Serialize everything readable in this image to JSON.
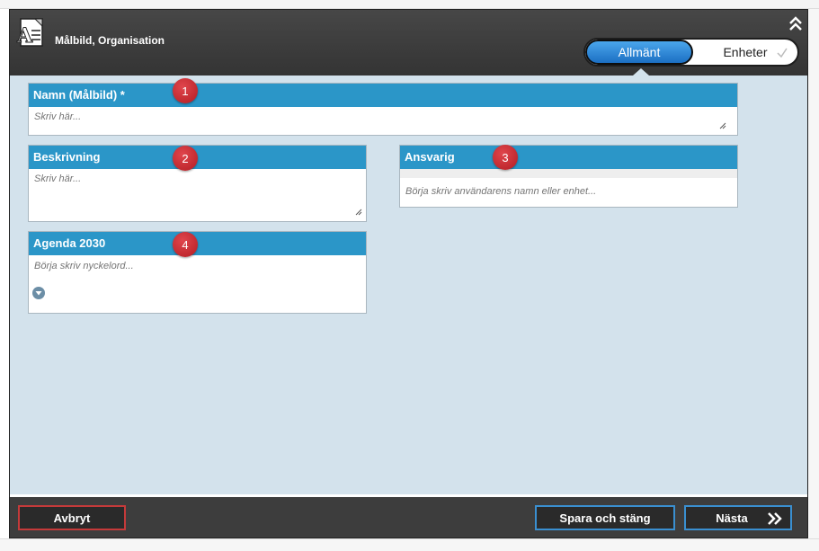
{
  "header": {
    "title": "Målbild, Organisation",
    "tabs": [
      {
        "label": "Allmänt",
        "active": true
      },
      {
        "label": "Enheter",
        "active": false
      }
    ]
  },
  "fields": {
    "name": {
      "label": "Namn (Målbild) *",
      "placeholder": "Skriv här...",
      "badge": "1"
    },
    "description": {
      "label": "Beskrivning",
      "placeholder": "Skriv här...",
      "badge": "2"
    },
    "responsible": {
      "label": "Ansvarig",
      "placeholder": "Börja skriv användarens namn eller enhet...",
      "badge": "3"
    },
    "agenda": {
      "label": "Agenda 2030",
      "placeholder": "Börja skriv nyckelord...",
      "badge": "4"
    }
  },
  "footer": {
    "cancel_label": "Avbryt",
    "save_close_label": "Spara och stäng",
    "next_label": "Nästa"
  },
  "colors": {
    "accent": "#2b96c8",
    "badge": "#c4262d",
    "content_bg": "#d3e2ec",
    "cancel_border": "#c43a3a",
    "primary_border": "#3a8fd0"
  },
  "icons": [
    "document-icon",
    "collapse-up-icon",
    "check-icon",
    "resize-handle-icon",
    "dropdown-circle-icon",
    "double-chevron-right-icon"
  ]
}
